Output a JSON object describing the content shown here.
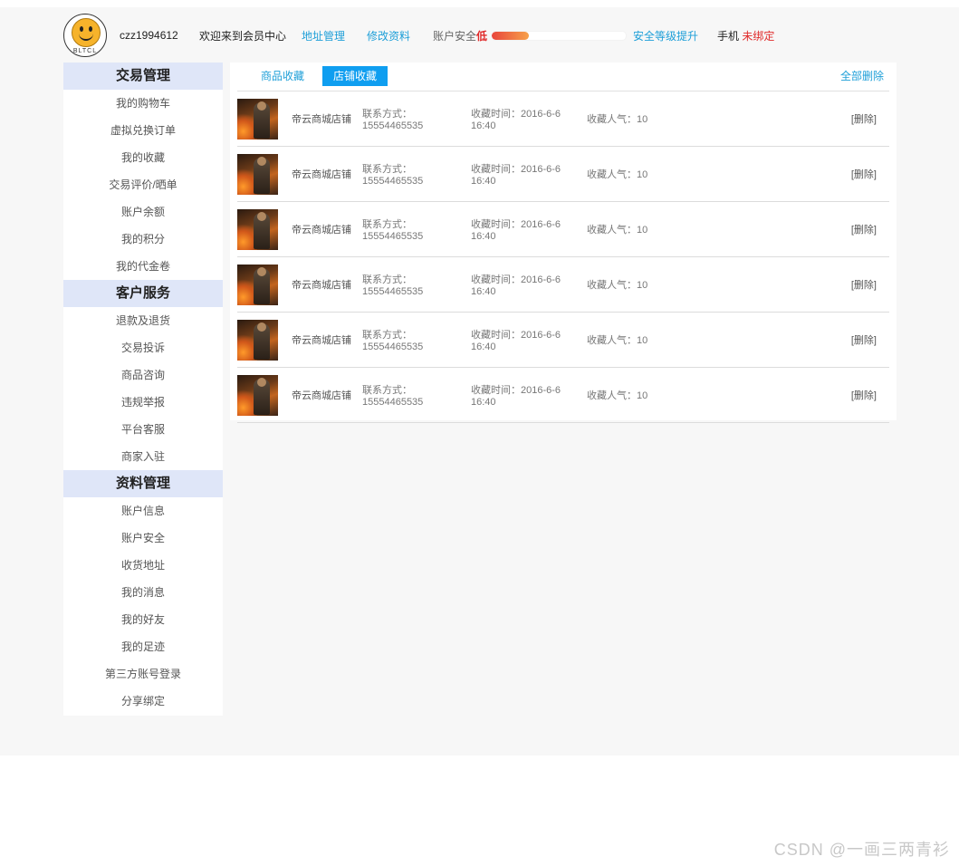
{
  "header": {
    "avatar_text": "BLTCL",
    "username": "czz1994612",
    "welcome": "欢迎来到会员中心",
    "address_link": "地址管理",
    "edit_link": "修改资料",
    "security_label": "账户安全",
    "security_level": "低",
    "security_progress": 0.28,
    "upgrade_link": "安全等级提升",
    "phone_label": "手机",
    "phone_status": "未绑定"
  },
  "sidebar": {
    "sections": [
      {
        "title": "交易管理",
        "items": [
          "我的购物车",
          "虚拟兑换订单",
          "我的收藏",
          "交易评价/晒单",
          "账户余额",
          "我的积分",
          "我的代金卷"
        ]
      },
      {
        "title": "客户服务",
        "items": [
          "退款及退货",
          "交易投诉",
          "商品咨询",
          "违规举报",
          "平台客服",
          "商家入驻"
        ]
      },
      {
        "title": "资料管理",
        "items": [
          "账户信息",
          "账户安全",
          "收货地址",
          "我的消息",
          "我的好友",
          "我的足迹",
          "第三方账号登录",
          "分享绑定"
        ]
      }
    ]
  },
  "main": {
    "tabs": [
      "商品收藏",
      "店铺收藏"
    ],
    "active_tab": 1,
    "delete_all": "全部删除",
    "rows": [
      {
        "shop": "帝云商城店铺",
        "contact": "联系方式：15554465535",
        "time": "收藏时间：2016-6-6 16:40",
        "popularity": "收藏人气：10",
        "delete": "[删除]"
      },
      {
        "shop": "帝云商城店铺",
        "contact": "联系方式：15554465535",
        "time": "收藏时间：2016-6-6 16:40",
        "popularity": "收藏人气：10",
        "delete": "[删除]"
      },
      {
        "shop": "帝云商城店铺",
        "contact": "联系方式：15554465535",
        "time": "收藏时间：2016-6-6 16:40",
        "popularity": "收藏人气：10",
        "delete": "[删除]"
      },
      {
        "shop": "帝云商城店铺",
        "contact": "联系方式：15554465535",
        "time": "收藏时间：2016-6-6 16:40",
        "popularity": "收藏人气：10",
        "delete": "[删除]"
      },
      {
        "shop": "帝云商城店铺",
        "contact": "联系方式：15554465535",
        "time": "收藏时间：2016-6-6 16:40",
        "popularity": "收藏人气：10",
        "delete": "[删除]"
      },
      {
        "shop": "帝云商城店铺",
        "contact": "联系方式：15554465535",
        "time": "收藏时间：2016-6-6 16:40",
        "popularity": "收藏人气：10",
        "delete": "[删除]"
      }
    ]
  },
  "watermark": "CSDN @一画三两青衫",
  "colors": {
    "link": "#1e9fd8",
    "active_tab": "#0f9ef0",
    "section_bg": "#dfe6f8",
    "danger": "#e02a2a"
  }
}
